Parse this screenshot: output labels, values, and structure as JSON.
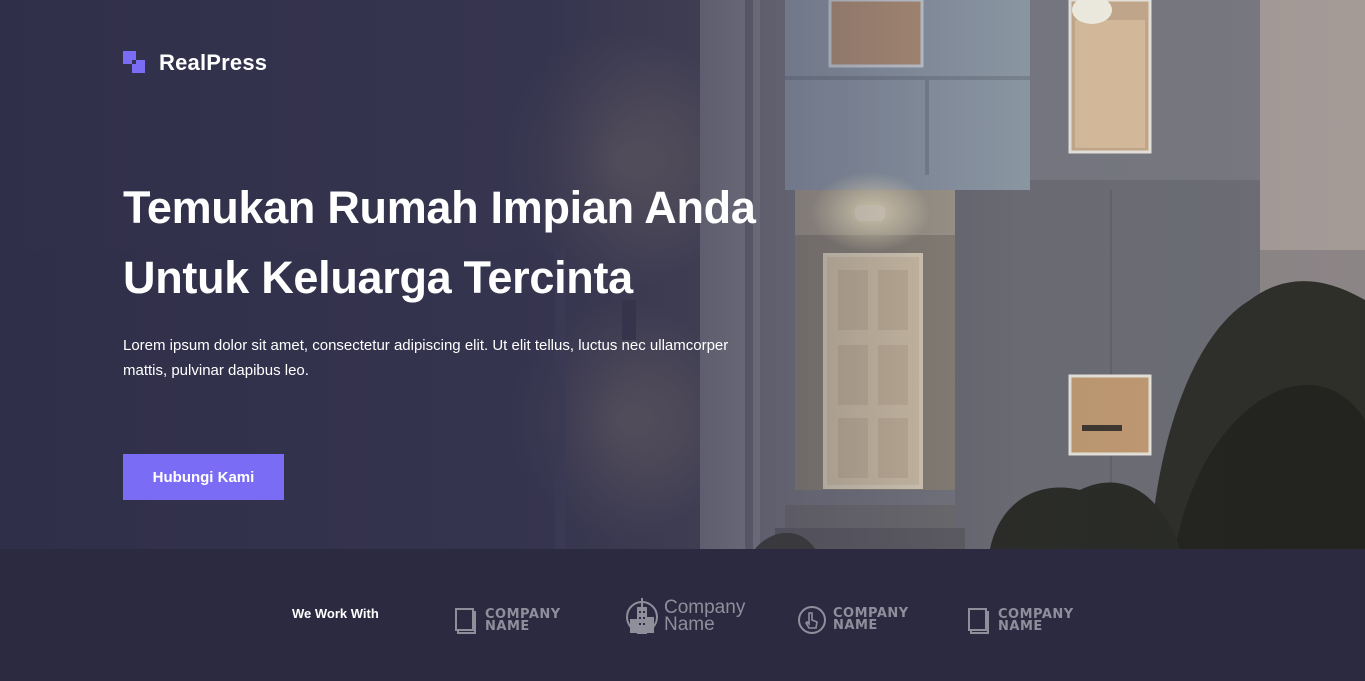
{
  "brand": {
    "name": "RealPress",
    "accent": "#7b6cf6"
  },
  "hero": {
    "headline_line1": "Temukan Rumah Impian Anda",
    "headline_line2": "Untuk Keluarga Tercinta",
    "lead_line1": "Lorem ipsum dolor sit amet, consectetur adipiscing elit. Ut elit tellus, luctus nec ullamcorper",
    "lead_line2": "mattis, pulvinar dapibus leo.",
    "cta_label": "Hubungi Kami"
  },
  "partners": {
    "label": "We Work With",
    "logos": [
      {
        "icon": "book-icon",
        "line1": "Company",
        "line2": "Name"
      },
      {
        "icon": "building-icon",
        "line1": "Company",
        "line2": "Name"
      },
      {
        "icon": "pointer-icon",
        "line1": "Company",
        "line2": "Name"
      },
      {
        "icon": "book-icon",
        "line1": "Company",
        "line2": "Name"
      }
    ]
  }
}
